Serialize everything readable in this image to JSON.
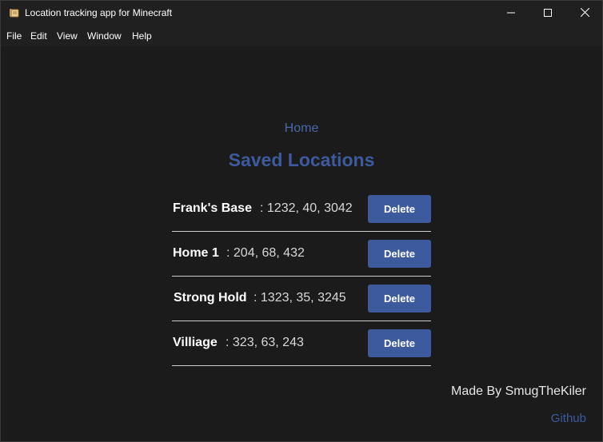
{
  "window": {
    "title": "Location tracking app for Minecraft",
    "icon": "scroll-icon",
    "controls": [
      "minimize-icon",
      "maximize-icon",
      "close-icon"
    ]
  },
  "menu": {
    "items": [
      {
        "label": "File"
      },
      {
        "label": "Edit"
      },
      {
        "label": "View"
      },
      {
        "label": "Window"
      },
      {
        "label": "Help"
      }
    ]
  },
  "page": {
    "home_link": "Home",
    "heading": "Saved Locations",
    "locations": [
      {
        "name": "Frank's Base",
        "coords": ": 1232, 40, 3042",
        "delete_label": "Delete"
      },
      {
        "name": "Home 1",
        "coords": ": 204, 68, 432",
        "delete_label": "Delete"
      },
      {
        "name": "Strong Hold",
        "coords": ": 1323, 35, 3245",
        "delete_label": "Delete"
      },
      {
        "name": "Villiage",
        "coords": ": 323, 63, 243",
        "delete_label": "Delete"
      }
    ],
    "footer": {
      "made_by": "Made By SmugTheKiler",
      "github": "Github"
    }
  },
  "colors": {
    "background": "#1b1b1b",
    "titlebar": "#202020",
    "accent": "#3e5a9e",
    "text": "#ffffff"
  }
}
